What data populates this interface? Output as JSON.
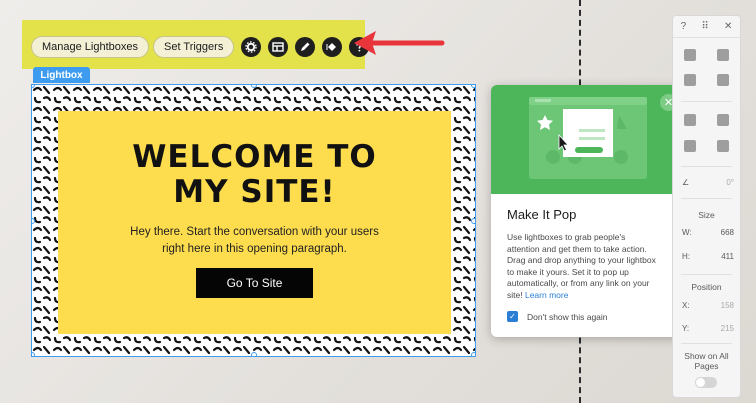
{
  "toolbar": {
    "manage_label": "Manage Lightboxes",
    "triggers_label": "Set Triggers",
    "icons": [
      "gear-icon",
      "layout-icon",
      "pen-icon",
      "animation-icon",
      "help-icon"
    ]
  },
  "lightbox": {
    "tag": "Lightbox",
    "headline_line1": "WELCOME TO",
    "headline_line2": "MY SITE!",
    "para_line1": "Hey there. Start the conversation with your users",
    "para_line2": "right here in this opening paragraph.",
    "button_label": "Go To Site"
  },
  "popup": {
    "title": "Make It Pop",
    "body_lines": [
      "Use lightboxes to grab people's",
      "attention and get them to take action.",
      "Drag and drop anything to your lightbox",
      "to make it yours. Set it to pop up",
      "automatically, or from any link on your"
    ],
    "body_last": "site!",
    "link_text": "Learn more",
    "checkbox_label": "Don't show this again",
    "checkbox_checked": true
  },
  "right_panel": {
    "top_q": "?",
    "top_close": "✕",
    "rotation": "0°",
    "size_label": "Size",
    "w_label": "W:",
    "w_value": "668",
    "h_label": "H:",
    "h_value": "411",
    "position_label": "Position",
    "x_label": "X:",
    "x_value": "158",
    "y_label": "Y:",
    "y_value": "215",
    "show_all_line1": "Show on All",
    "show_all_line2": "Pages"
  },
  "colors": {
    "highlight": "#e3e24a",
    "selection_blue": "#3d9cf0",
    "card_yellow": "#fddd4d",
    "pop_green": "#4eb65a",
    "arrow_red": "#e8343b"
  }
}
